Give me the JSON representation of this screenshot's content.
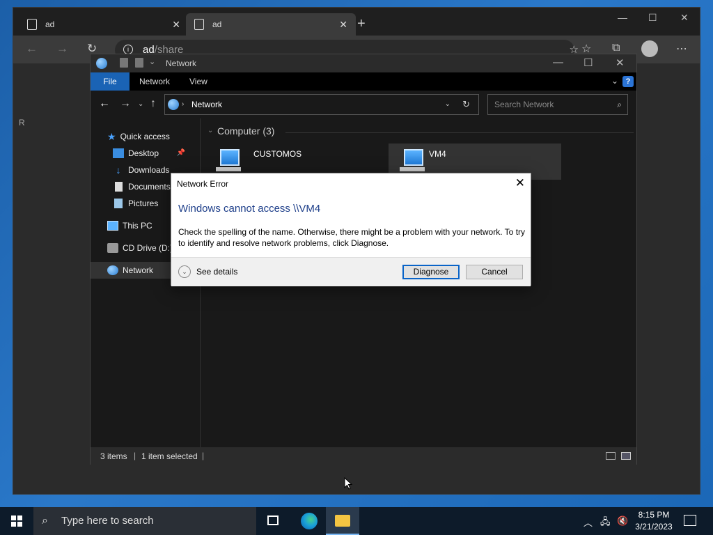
{
  "browser": {
    "tabs": [
      {
        "label": "ad",
        "close": "✕"
      },
      {
        "label": "ad",
        "close": "✕"
      }
    ],
    "new_tab": "+",
    "url_host": "ad",
    "url_path": "/share",
    "left_fragment": "R"
  },
  "explorer": {
    "title": "Network",
    "ribbon": [
      "File",
      "Network",
      "View"
    ],
    "help": "?",
    "address": "Network",
    "search_placeholder": "Search Network",
    "nav": {
      "quick_access": "Quick access",
      "items": [
        "Desktop",
        "Downloads",
        "Documents",
        "Pictures"
      ],
      "this_pc": "This PC",
      "cd_drive": "CD Drive (D:)",
      "network": "Network"
    },
    "group_header": "Computer (3)",
    "computers": [
      "CUSTOMOS",
      "VM4"
    ],
    "status": {
      "items": "3 items",
      "selected": "1 item selected"
    }
  },
  "dialog": {
    "title": "Network Error",
    "heading": "Windows cannot access \\\\VM4",
    "message": "Check the spelling of the name. Otherwise, there might be a problem with your network. To try to identify and resolve network problems, click Diagnose.",
    "see_details": "See details",
    "diagnose": "Diagnose",
    "cancel": "Cancel",
    "close": "✕"
  },
  "taskbar": {
    "search_placeholder": "Type here to search",
    "time": "8:15 PM",
    "date": "3/21/2023"
  },
  "colors": {
    "ribbon_file": "#1a63b5",
    "dialog_heading": "#1e3f8a",
    "primary_button_border": "#0a64c8",
    "taskbar": "#0d1b2a"
  }
}
